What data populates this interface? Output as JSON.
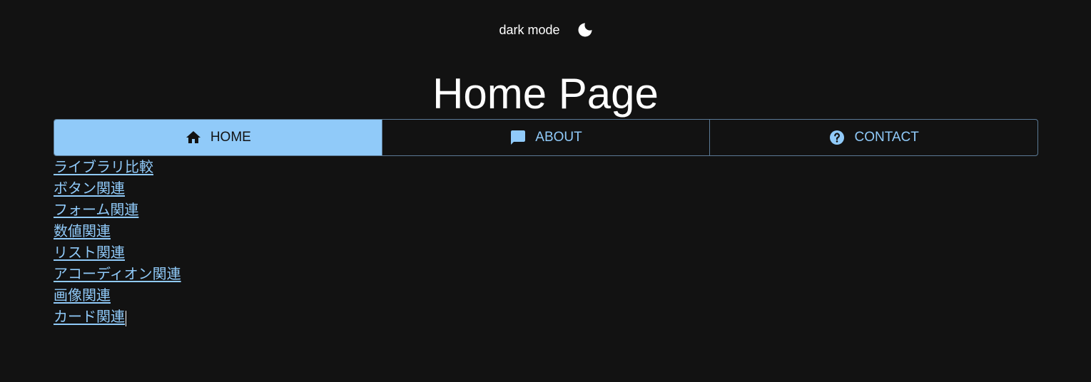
{
  "header": {
    "mode_label": "dark mode",
    "mode_icon": "moon-icon"
  },
  "page": {
    "title": "Home Page"
  },
  "tabs": [
    {
      "label": "HOME",
      "icon": "home-icon",
      "active": true
    },
    {
      "label": "ABOUT",
      "icon": "chat-icon",
      "active": false
    },
    {
      "label": "CONTACT",
      "icon": "help-circle-icon",
      "active": false
    }
  ],
  "links": [
    "ライブラリ比較",
    "ボタン関連",
    "フォーム関連",
    "数値関連",
    "リスト関連",
    "アコーディオン関連",
    "画像関連",
    "カード関連"
  ],
  "colors": {
    "background": "#121212",
    "accent": "#90caf9",
    "border": "#5b7a96"
  }
}
